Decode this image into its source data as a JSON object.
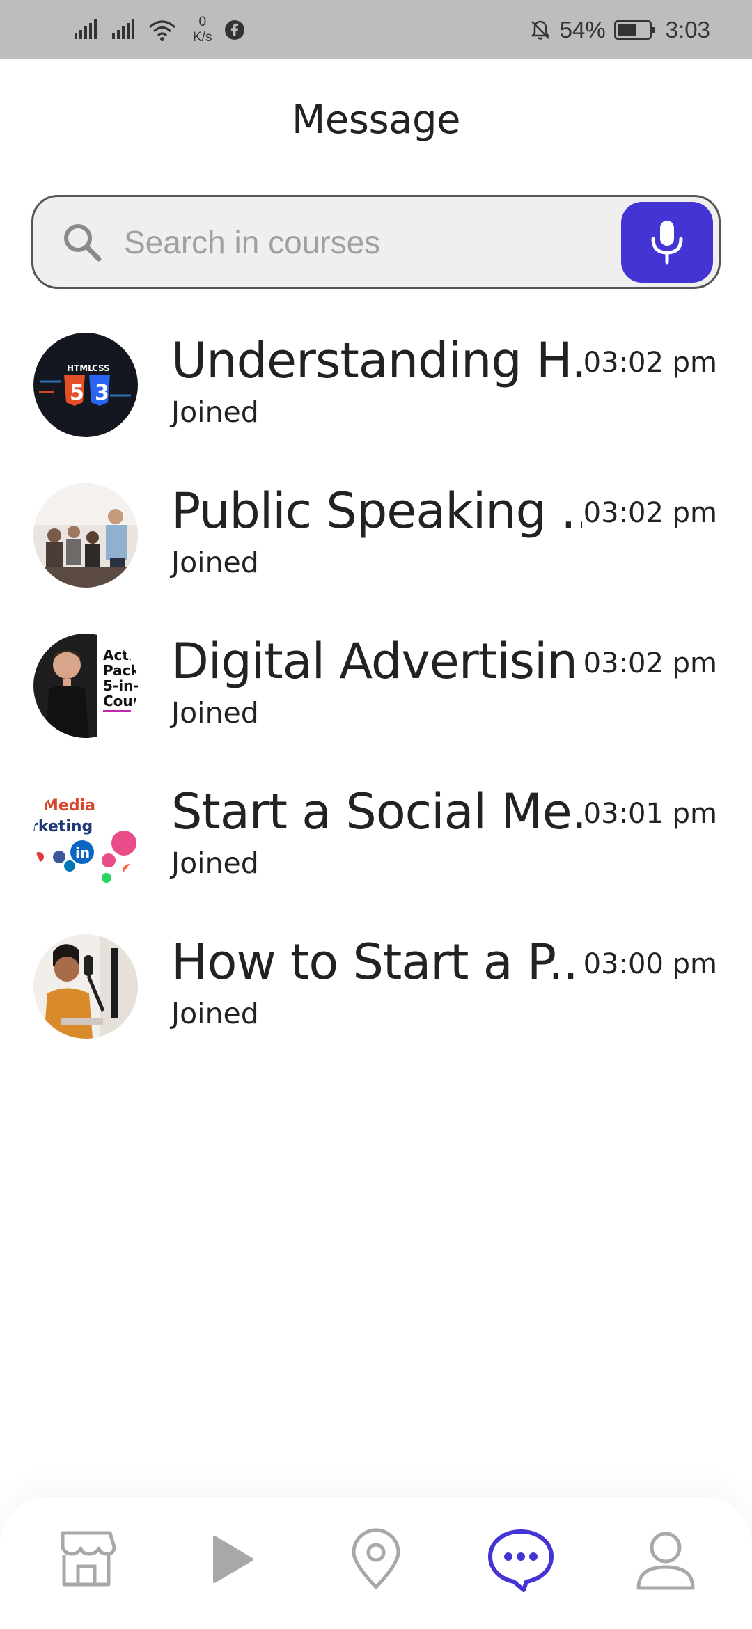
{
  "status_bar": {
    "net_speed_value": "0",
    "net_speed_unit": "K/s",
    "battery": "54%",
    "battery_level": 0.54,
    "time": "3:03"
  },
  "header": {
    "title": "Message"
  },
  "search": {
    "placeholder": "Search in courses"
  },
  "chats": [
    {
      "title": "Understanding H...",
      "status": "Joined",
      "time": "03:02 pm",
      "avatar": "html-css-course-thumbnail"
    },
    {
      "title": "Public Speaking ...",
      "status": "Joined",
      "time": "03:02 pm",
      "avatar": "public-speaking-course-thumbnail"
    },
    {
      "title": "Digital Advertisin...",
      "status": "Joined",
      "time": "03:02 pm",
      "avatar": "digital-advertising-course-thumbnail"
    },
    {
      "title": "Start a Social Me...",
      "status": "Joined",
      "time": "03:01 pm",
      "avatar": "social-media-course-thumbnail"
    },
    {
      "title": "How to Start a P...",
      "status": "Joined",
      "time": "03:00 pm",
      "avatar": "podcast-course-thumbnail"
    }
  ],
  "avatar_text": {
    "html_label": "HTML",
    "css_label": "CSS",
    "html_number": "5",
    "css_number": "3",
    "ad_lines": [
      "Acti",
      "Pack",
      "5-in-",
      "Cour"
    ],
    "social_lines": [
      "Media",
      "rketing"
    ],
    "social_badge": "in"
  },
  "bottom_nav": {
    "items": [
      "store-icon",
      "play-icon",
      "location-icon",
      "chat-icon",
      "profile-icon"
    ],
    "active": "chat-icon"
  },
  "colors": {
    "accent": "#4534d4",
    "status_bar": "#bdbdbd",
    "inactive_icon": "#a8a8a8",
    "text": "#222222"
  }
}
